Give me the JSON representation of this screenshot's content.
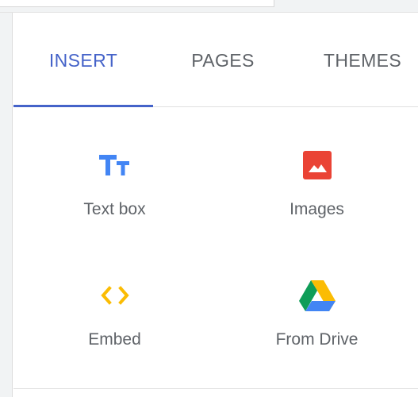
{
  "tabs": [
    {
      "label": "INSERT",
      "active": true
    },
    {
      "label": "PAGES",
      "active": false
    },
    {
      "label": "THEMES",
      "active": false
    }
  ],
  "items": [
    {
      "label": "Text box",
      "icon": "text-box-icon",
      "color": "#4285f4"
    },
    {
      "label": "Images",
      "icon": "image-icon",
      "color": "#ea4335"
    },
    {
      "label": "Embed",
      "icon": "embed-code-icon",
      "color": "#fbbc04"
    },
    {
      "label": "From Drive",
      "icon": "google-drive-icon",
      "colors": [
        "#0f9d58",
        "#fbbc04",
        "#4285f4"
      ]
    }
  ],
  "colors": {
    "accent": "#4563c9",
    "text_muted": "#5f6368",
    "divider": "#e0e0e0"
  }
}
